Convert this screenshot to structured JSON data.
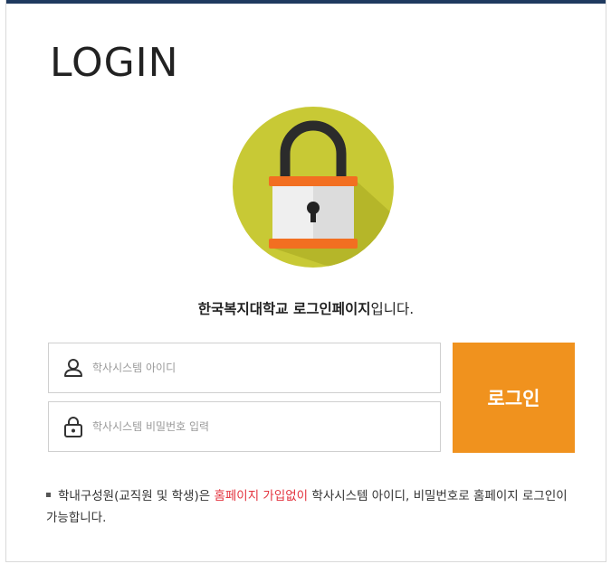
{
  "page": {
    "title": "LOGIN",
    "welcome_bold": "한국복지대학교 로그인페이지",
    "welcome_rest": "입니다."
  },
  "form": {
    "id_placeholder": "학사시스템 아이디",
    "id_value": "",
    "pw_placeholder": "학사시스템 비밀번호 입력",
    "pw_value": "",
    "login_label": "로그인"
  },
  "notice": {
    "part1": "학내구성원(교직원 및 학생)은 ",
    "highlight": "홈페이지 가입없이",
    "part2": " 학사시스템 아이디, 비밀번호로 홈페이지 로그인이 가능합니다."
  },
  "icons": {
    "lock_logo": "padlock-icon",
    "id_icon": "user-icon",
    "pw_icon": "lock-icon"
  },
  "colors": {
    "accent": "#f0921e",
    "highlight": "#e3343f",
    "logo_circle": "#c8c935",
    "top_bar": "#1f3a5f"
  }
}
